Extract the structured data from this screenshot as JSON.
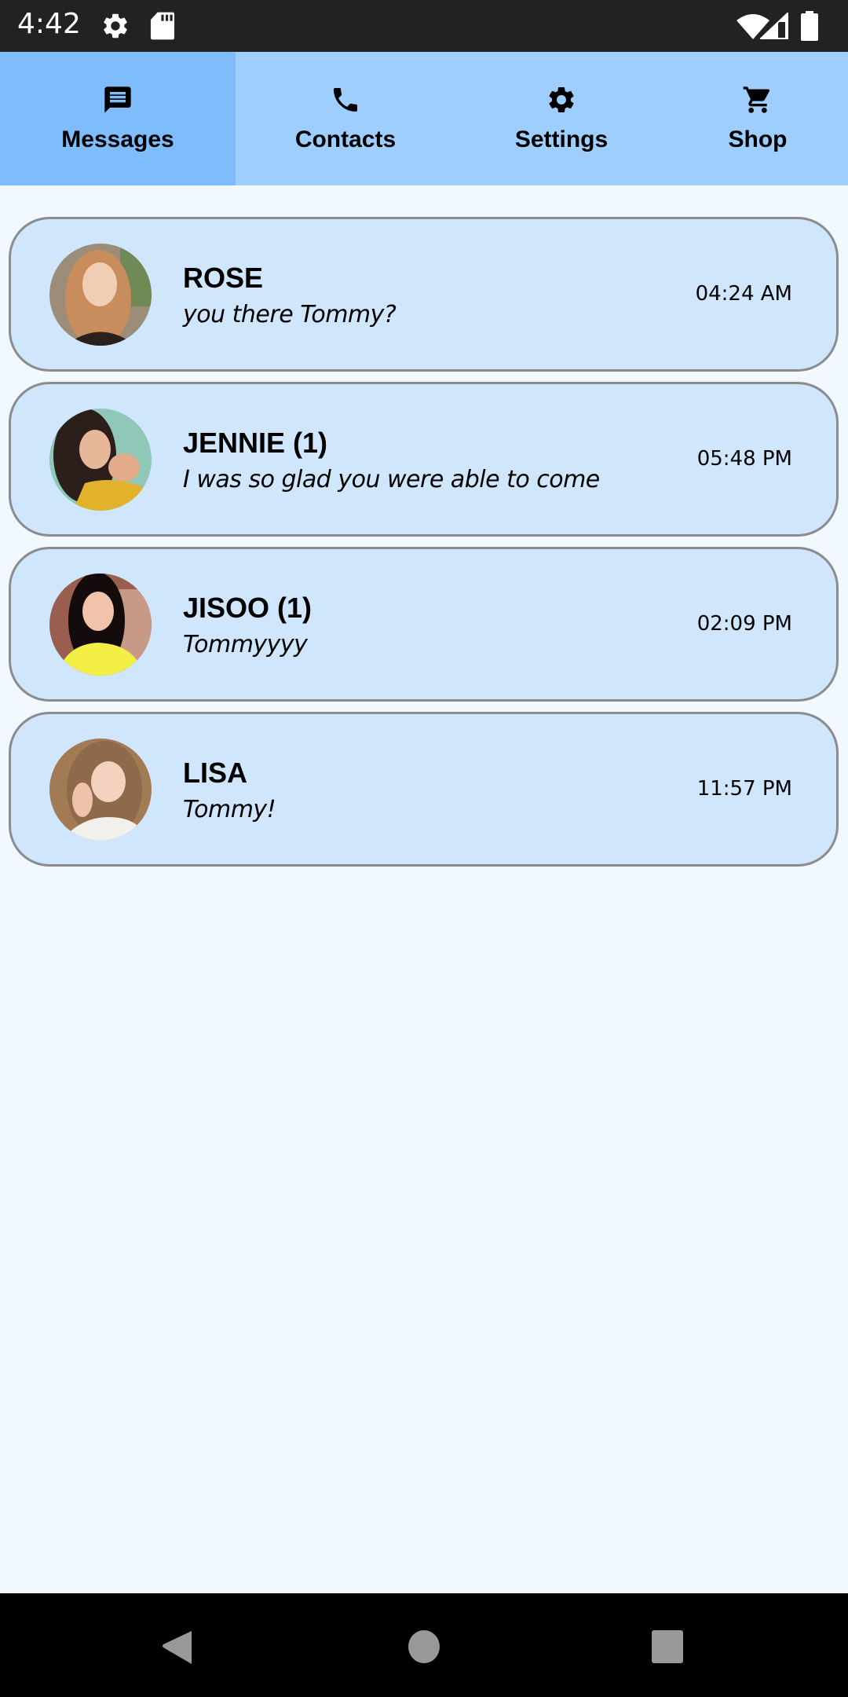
{
  "status_bar": {
    "time": "4:42",
    "left_icons": [
      "settings-gear-icon",
      "sd-card-icon"
    ],
    "right_icons": [
      "wifi-icon",
      "cellular-signal-icon",
      "battery-icon"
    ]
  },
  "tabs": [
    {
      "label": "Messages",
      "icon": "message-icon",
      "active": true
    },
    {
      "label": "Contacts",
      "icon": "phone-icon",
      "active": false
    },
    {
      "label": "Settings",
      "icon": "gear-icon",
      "active": false
    },
    {
      "label": "Shop",
      "icon": "cart-icon",
      "active": false
    }
  ],
  "conversations": [
    {
      "name": "ROSE",
      "preview": "you there Tommy?",
      "time": "04:24 AM"
    },
    {
      "name": "JENNIE (1)",
      "preview": "I was so glad you were able to come",
      "time": "05:48 PM"
    },
    {
      "name": "JISOO (1)",
      "preview": "Tommyyyy",
      "time": "02:09 PM"
    },
    {
      "name": "LISA",
      "preview": "Tommy!",
      "time": "11:57 PM"
    }
  ],
  "colors": {
    "tabbar": "#9dcefd",
    "tab_active": "#7ebcfb",
    "card": "#cfe6fd",
    "card_border": "#8a8c8e",
    "background": "#f1f9fe"
  },
  "nav_bar": [
    "back-button",
    "home-button",
    "recents-button"
  ]
}
